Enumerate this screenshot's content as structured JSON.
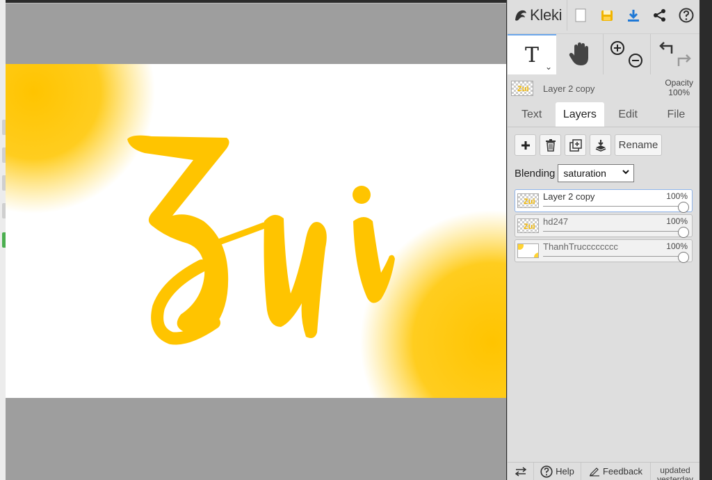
{
  "app": {
    "name": "Kleki",
    "accent": "#6aa6ea"
  },
  "canvas": {
    "art_text": "Zui",
    "art_color": "#ffc400",
    "glow_color": "#ffd333"
  },
  "tools": {
    "text_glyph": "T",
    "chevron": "⌄"
  },
  "current_layer": {
    "name": "Layer 2 copy",
    "opacity_label": "Opacity",
    "opacity_value": "100%"
  },
  "tabs": [
    {
      "label": "Text"
    },
    {
      "label": "Layers"
    },
    {
      "label": "Edit"
    },
    {
      "label": "File"
    }
  ],
  "actions": {
    "rename_label": "Rename"
  },
  "blending": {
    "label": "Blending",
    "value": "saturation"
  },
  "layers": [
    {
      "name": "Layer 2 copy",
      "opacity": "100%",
      "selected": true
    },
    {
      "name": "hd247",
      "opacity": "100%",
      "selected": false
    },
    {
      "name": "ThanhTrucccccccc",
      "opacity": "100%",
      "selected": false
    }
  ],
  "footer": {
    "help_label": "Help",
    "feedback_label": "Feedback",
    "updated_label": "updated yesterday"
  }
}
